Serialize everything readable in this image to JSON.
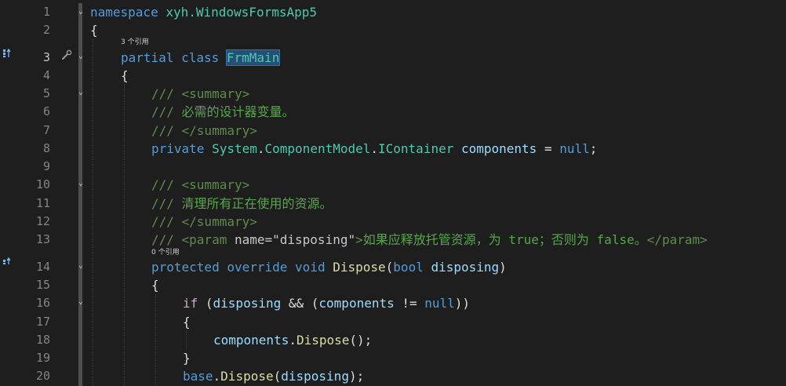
{
  "editor": {
    "line_numbers": [
      "1",
      "2",
      "3",
      "4",
      "5",
      "6",
      "7",
      "8",
      "9",
      "10",
      "11",
      "12",
      "13",
      "14",
      "15",
      "16",
      "17",
      "18",
      "19",
      "20"
    ],
    "codelens": {
      "class_refs": "3 个引用",
      "method_refs": "0 个引用"
    },
    "lines": {
      "l1": {
        "kw": "namespace",
        "sp": " ",
        "ns": "xyh.WindowsFormsApp5"
      },
      "l2": {
        "brace": "{"
      },
      "l3": {
        "kw1": "partial",
        "kw2": "class",
        "name": "FrmMain"
      },
      "l4": {
        "brace": "{"
      },
      "l5": {
        "slash": "/// ",
        "tag": "<summary>"
      },
      "l6": {
        "slash": "/// ",
        "text": "必需的设计器变量。"
      },
      "l7": {
        "slash": "/// ",
        "tag": "</summary>"
      },
      "l8": {
        "kw": "private",
        "ns1": "System",
        "dot1": ".",
        "ns2": "ComponentModel",
        "dot2": ".",
        "type": "IContainer",
        "var": "components",
        "eq": " = ",
        "null": "null",
        "end": ";"
      },
      "l10": {
        "slash": "/// ",
        "tag": "<summary>"
      },
      "l11": {
        "slash": "/// ",
        "text": "清理所有正在使用的资源。"
      },
      "l12": {
        "slash": "/// ",
        "tag": "</summary>"
      },
      "l13": {
        "slash": "/// ",
        "tag_open": "<param ",
        "attr": "name",
        "eqq": "=\"",
        "val": "disposing",
        "close_q": "\"",
        "gt": ">",
        "text": "如果应释放托管资源，为 true；否则为 false。",
        "tag_close": "</param>"
      },
      "l14": {
        "kw1": "protected",
        "kw2": "override",
        "kw3": "void",
        "method": "Dispose",
        "p1": "(",
        "kw4": "bool",
        "var": "disposing",
        "p2": ")"
      },
      "l15": {
        "brace": "{"
      },
      "l16": {
        "ctl": "if",
        "p1": " (",
        "var1": "disposing",
        "op": " && (",
        "var2": "components",
        "neq": " != ",
        "null": "null",
        "p2": "))"
      },
      "l17": {
        "brace": "{"
      },
      "l18": {
        "var": "components",
        "dot": ".",
        "method": "Dispose",
        "end": "();"
      },
      "l19": {
        "brace": "}"
      },
      "l20": {
        "kw": "base",
        "dot": ".",
        "method": "Dispose",
        "p1": "(",
        "var": "disposing",
        "end": ");"
      }
    }
  },
  "colors": {
    "background": "#1e1e1e",
    "keyword": "#569cd6",
    "type": "#4ec9b0",
    "comment": "#57a64a",
    "method": "#dcdcaa",
    "variable": "#9cdcfe",
    "control": "#d8a0df",
    "selection": "#264f78"
  },
  "icons": {
    "glyph_line3": "implementation-icon",
    "glyph_line14": "override-icon",
    "wrench_line3": "quick-action-icon"
  }
}
